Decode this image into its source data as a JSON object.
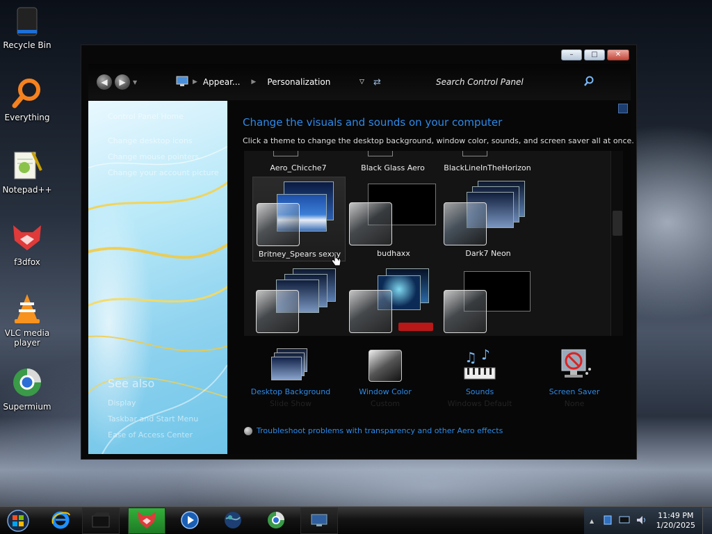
{
  "desktop": {
    "icons": [
      {
        "label": "Recycle Bin"
      },
      {
        "label": "Everything"
      },
      {
        "label": "Notepad++"
      },
      {
        "label": "f3dfox"
      },
      {
        "label": "VLC media player"
      },
      {
        "label": "Supermium"
      }
    ]
  },
  "window": {
    "caption": {
      "minimize": "–",
      "maximize": "□",
      "close": "✕"
    },
    "toolbar": {
      "breadcrumb": [
        "Appear...",
        "Personalization"
      ],
      "search_placeholder": "Search Control Panel"
    },
    "left_pane": {
      "links": [
        "Control Panel Home",
        "Change desktop icons",
        "Change mouse pointers",
        "Change your account picture"
      ],
      "see_also_heading": "See also",
      "see_also_links": [
        "Display",
        "Taskbar and Start Menu",
        "Ease of Access Center"
      ]
    },
    "main": {
      "title": "Change the visuals and sounds on your computer",
      "subtitle": "Click a theme to change the desktop background, window color, sounds, and screen saver all at once.",
      "themes_top_row": [
        "Aero_Chicche7",
        "Black Glass Aero",
        "BlackLineInTheHorizon"
      ],
      "themes": [
        {
          "name": "Britney_Spears sexxy",
          "selected": true
        },
        {
          "name": "budhaxx",
          "selected": false
        },
        {
          "name": "Dark7 Neon",
          "selected": false
        }
      ],
      "bottom_items": [
        {
          "label": "Desktop Background",
          "value": "Slide Show"
        },
        {
          "label": "Window Color",
          "value": "Custom"
        },
        {
          "label": "Sounds",
          "value": "Windows Default"
        },
        {
          "label": "Screen Saver",
          "value": "None"
        }
      ],
      "troubleshoot": "Troubleshoot problems with transparency and other Aero effects"
    }
  },
  "taskbar": {
    "clock_time": "11:49 PM",
    "clock_date": "1/20/2025"
  },
  "colors": {
    "link": "#2e8ae8",
    "window_bg": "#080808"
  }
}
